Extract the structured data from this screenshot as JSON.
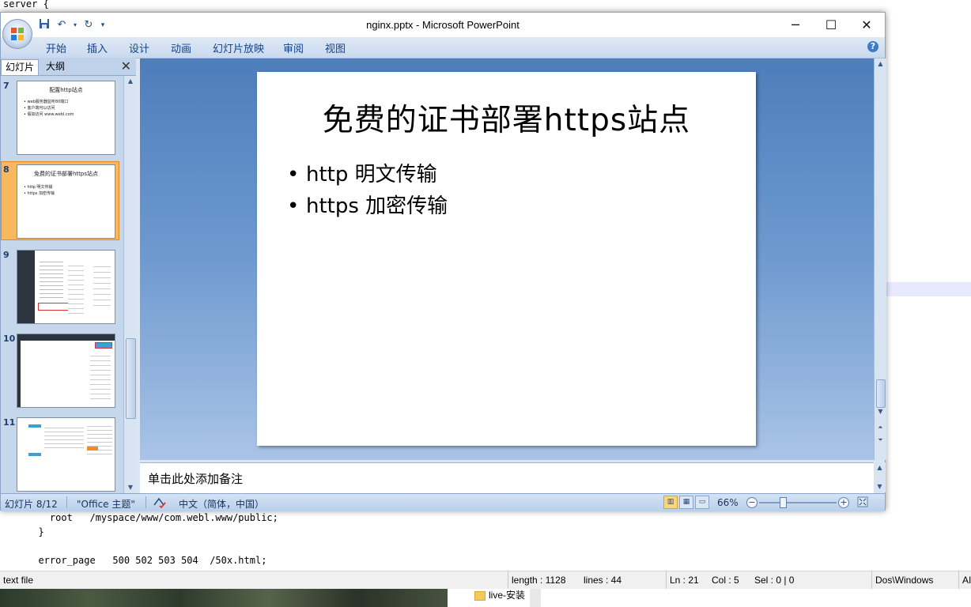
{
  "background_editor": {
    "line_top": "server {",
    "line_root": "    root   /myspace/www/com.webl.www/public;",
    "line_brace": "  }",
    "line_error": "  error_page   500 502 503 504  /50x.html;",
    "status": {
      "file_type": "text file",
      "length": "length : 1128",
      "lines": "lines : 44",
      "ln": "Ln : 21",
      "col": "Col : 5",
      "sel": "Sel : 0 | 0",
      "eol": "Dos\\Windows",
      "encoding_partial": "AI"
    }
  },
  "desktop": {
    "folder_label": "live-安装"
  },
  "window": {
    "title": "nginx.pptx - Microsoft PowerPoint",
    "qat": {
      "save_icon": "save-icon",
      "undo_icon": "undo-icon",
      "redo_icon": "redo-icon"
    }
  },
  "ribbon": {
    "tabs": [
      "开始",
      "插入",
      "设计",
      "动画",
      "幻灯片放映",
      "审阅",
      "视图"
    ]
  },
  "left_pane": {
    "tab_slides": "幻灯片",
    "tab_outline": "大纲",
    "thumbnails": [
      {
        "number": "7",
        "title": "配置http站点",
        "bullets": [
          "web服务器监听80端口",
          "客户端可以访问",
          "假如访问 www.webl.com"
        ]
      },
      {
        "number": "8",
        "title": "免费的证书部署https站点",
        "bullets": [
          "http 明文传输",
          "https 加密传输"
        ]
      },
      {
        "number": "9"
      },
      {
        "number": "10"
      },
      {
        "number": "11"
      }
    ]
  },
  "slide": {
    "title": "免费的证书部署https站点",
    "bullets": [
      "http 明文传输",
      "https 加密传输"
    ]
  },
  "notes_placeholder": "单击此处添加备注",
  "status_bar": {
    "slide_pos": "幻灯片 8/12",
    "theme": "\"Office 主题\"",
    "language": "中文（简体，中国）",
    "zoom": "66%"
  }
}
